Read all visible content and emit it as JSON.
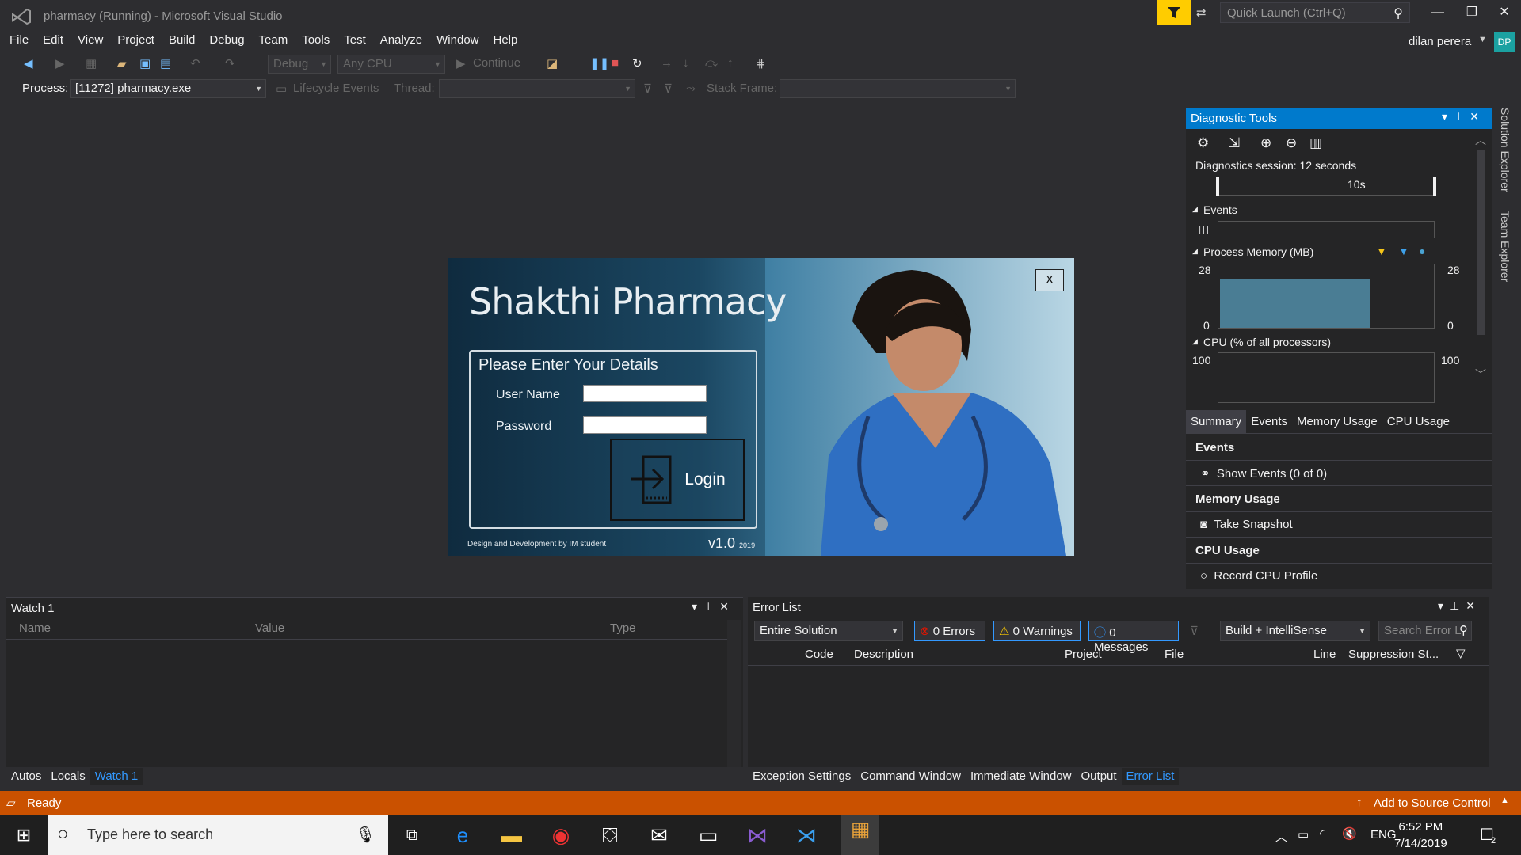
{
  "window": {
    "title": "pharmacy (Running) - Microsoft Visual Studio",
    "quick_launch_placeholder": "Quick Launch (Ctrl+Q)",
    "user_name": "dilan perera",
    "user_initials": "DP"
  },
  "menu": [
    "File",
    "Edit",
    "View",
    "Project",
    "Build",
    "Debug",
    "Team",
    "Tools",
    "Test",
    "Analyze",
    "Window",
    "Help"
  ],
  "toolbar": {
    "config": "Debug",
    "platform": "Any CPU",
    "continue_label": "Continue"
  },
  "debug_toolbar": {
    "process_label": "Process:",
    "process_value": "[11272] pharmacy.exe",
    "lifecycle_label": "Lifecycle Events",
    "thread_label": "Thread:",
    "stack_frame_label": "Stack Frame:"
  },
  "app_dialog": {
    "title": "Shakthi Pharmacy",
    "close_label": "x",
    "form_title": "Please Enter Your Details",
    "username_label": "User Name",
    "password_label": "Password",
    "login_label": "Login",
    "credit": "Design and Development by IM student",
    "version": "v1.0",
    "year": "2019"
  },
  "diagnostic_tools": {
    "title": "Diagnostic Tools",
    "session": "Diagnostics session: 12 seconds",
    "timeline_tick": "10s",
    "events_label": "Events",
    "memory_label": "Process Memory (MB)",
    "memory_max": "28",
    "memory_min": "0",
    "memory_fraction": 0.78,
    "cpu_label": "CPU (% of all processors)",
    "cpu_max": "100",
    "tabs": [
      "Summary",
      "Events",
      "Memory Usage",
      "CPU Usage"
    ],
    "sections": {
      "events": "Events",
      "show_events": "Show Events (0 of 0)",
      "memory_usage": "Memory Usage",
      "take_snapshot": "Take Snapshot",
      "cpu_usage": "CPU Usage",
      "record_cpu": "Record CPU Profile"
    }
  },
  "side_tabs": [
    "Solution Explorer",
    "Team Explorer"
  ],
  "watch": {
    "title": "Watch 1",
    "columns": [
      "Name",
      "Value",
      "Type"
    ],
    "bottom_tabs": [
      "Autos",
      "Locals",
      "Watch 1"
    ]
  },
  "error_list": {
    "title": "Error List",
    "scope": "Entire Solution",
    "errors": "0 Errors",
    "warnings": "0 Warnings",
    "messages": "0 Messages",
    "build_filter": "Build + IntelliSense",
    "search_placeholder": "Search Error L",
    "columns": [
      "Code",
      "Description",
      "Project",
      "File",
      "Line",
      "Suppression St..."
    ],
    "bottom_tabs": [
      "Exception Settings",
      "Command Window",
      "Immediate Window",
      "Output",
      "Error List"
    ]
  },
  "status": {
    "text": "Ready",
    "source_control": "Add to Source Control"
  },
  "taskbar": {
    "search_placeholder": "Type here to search",
    "language": "ENG",
    "time": "6:52 PM",
    "date": "7/14/2019",
    "notification_count": "2"
  },
  "colors": {
    "accent": "#007acc",
    "statusbar": "#ca5100",
    "filter_button": "#ffcc00"
  }
}
